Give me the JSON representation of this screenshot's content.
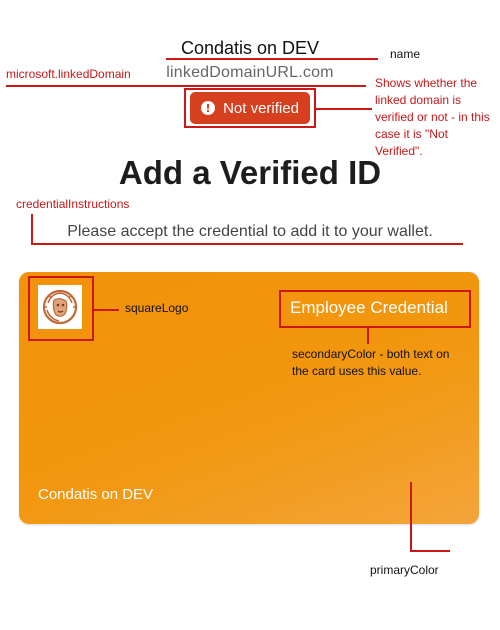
{
  "header": {
    "issuer_name": "Condatis on DEV",
    "linked_domain_url": "linkedDomainURL.com",
    "verification_status": "Not verified",
    "alert_glyph": "!"
  },
  "page_title": "Add a Verified ID",
  "credential_instructions": "Please accept the credential to add it to your wallet.",
  "card": {
    "title": "Employee Credential",
    "issuer": "Condatis on DEV",
    "logo_icon": "lion-face-logo",
    "primary_color": "#f2950d",
    "secondary_color": "#ffffff"
  },
  "annotations": {
    "name": "name",
    "linked_domain": "microsoft.linkedDomain",
    "verified_note": "Shows whether the linked domain is verified or not - in this case it is \"Not Verified\".",
    "credential_instructions": "credentialInstructions",
    "square_logo": "squareLogo",
    "secondary_color": "secondaryColor - both text on the card uses this value.",
    "primary_color": "primaryColor"
  },
  "colors": {
    "annotation_red": "#cc1717",
    "badge_red": "#d7401f"
  }
}
